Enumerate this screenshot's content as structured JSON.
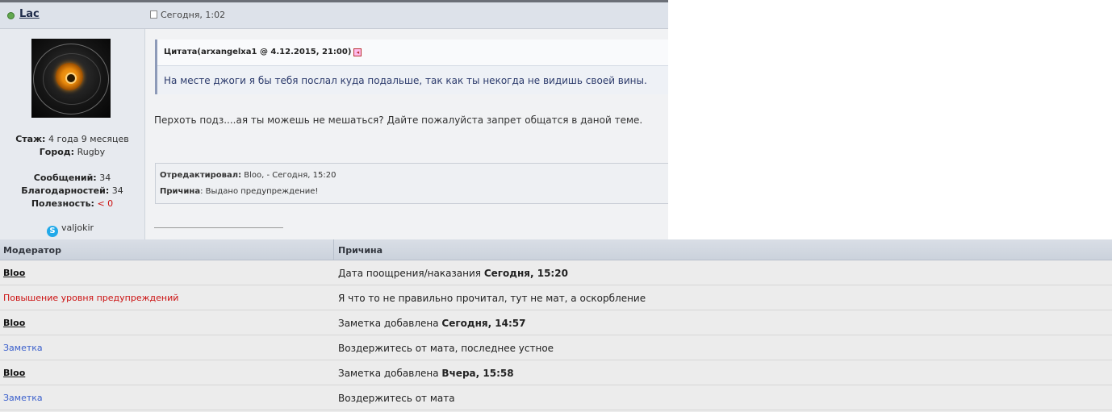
{
  "post": {
    "author": "Lac",
    "date": "Сегодня, 1:02",
    "stats": {
      "stazh_label": "Стаж:",
      "stazh_value": "4 года 9 месяцев",
      "city_label": "Город:",
      "city_value": "Rugby",
      "messages_label": "Сообщений:",
      "messages_value": "34",
      "thanks_label": "Благодарностей:",
      "thanks_value": "34",
      "usefulness_label": "Полезность:",
      "usefulness_value": "< 0"
    },
    "skype": "valjokir",
    "quote": {
      "title": "Цитата(arxangelxa1 @ 4.12.2015, 21:00)",
      "text": "На месте джоги я бы тебя послал куда подальше, так как ты некогда не видишь своей вины."
    },
    "body": "Перхоть подз....ая ты можешь не мешаться? Дайте пожалуйста запрет общатся в даной теме.",
    "edit": {
      "by_label": "Отредактировал:",
      "by_value": "Bloo, - Сегодня, 15:20",
      "reason_label": "Причина",
      "reason_value": ": Выдано предупреждение!"
    },
    "colors": {
      "header": "#dde2ea",
      "author_col": "#e7eaef",
      "quote_border": "#8d9ab8",
      "online": "#62a84f"
    }
  },
  "mod_table": {
    "headers": {
      "moderator": "Модератор",
      "reason": "Причина"
    },
    "rows": [
      {
        "moderator": "Bloo",
        "style": "link",
        "reason_pre": "Дата поощрения/наказания ",
        "reason_bold": "Сегодня, 15:20"
      },
      {
        "moderator": "Повышение уровня предупреждений",
        "style": "red",
        "reason_pre": "Я что то не правильно прочитал, тут не мат, а оскорбление",
        "reason_bold": ""
      },
      {
        "moderator": "Bloo",
        "style": "link",
        "reason_pre": "Заметка добавлена ",
        "reason_bold": "Сегодня, 14:57"
      },
      {
        "moderator": "Заметка",
        "style": "blue",
        "reason_pre": "Воздержитесь от мата, последнее устное",
        "reason_bold": ""
      },
      {
        "moderator": "Bloo",
        "style": "link",
        "reason_pre": "Заметка добавлена ",
        "reason_bold": "Вчера, 15:58"
      },
      {
        "moderator": "Заметка",
        "style": "blue",
        "reason_pre": "Воздержитесь от мата",
        "reason_bold": ""
      }
    ],
    "colors": {
      "warn": "#cc1111",
      "note": "#3a5fcc"
    }
  }
}
